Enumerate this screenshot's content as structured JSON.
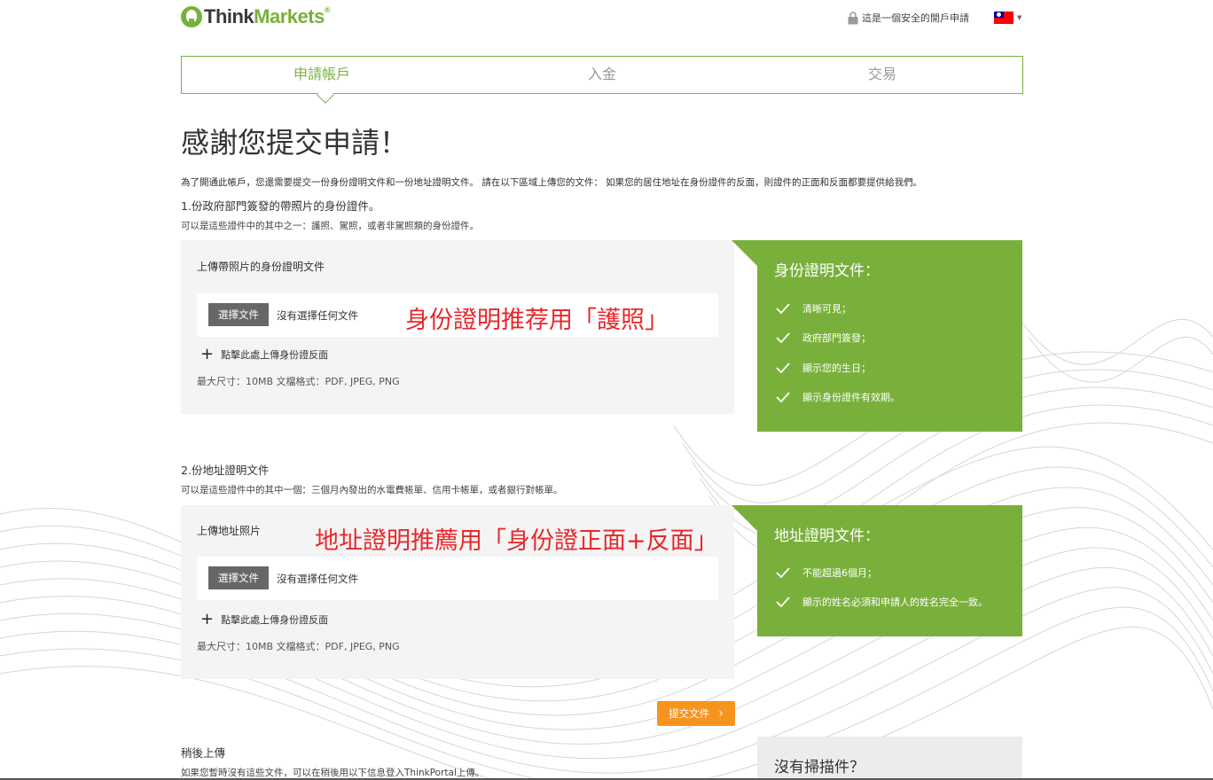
{
  "header": {
    "logo_think": "Think",
    "logo_markets": "Markets",
    "logo_reg": "®",
    "secure_text": "這是一個安全的開戶申請",
    "lock_icon": "lock-icon",
    "flag_icon": "taiwan-flag-icon"
  },
  "stepper": {
    "steps": [
      {
        "label": "申請帳戶",
        "active": true
      },
      {
        "label": "入金",
        "active": false
      },
      {
        "label": "交易",
        "active": false
      }
    ]
  },
  "main": {
    "title": "感謝您提交申請！",
    "intro": "為了開通此帳戶，您還需要提交一份身份證明文件和一份地址證明文件。 請在以下區域上傳您的文件： 如果您的居住地址在身份證件的反面，則證件的正面和反面都要提供給我們。",
    "section1": {
      "title": "1.份政府部門簽發的帶照片的身份證件。",
      "desc": "可以是這些證件中的其中之一：護照、駕照，或者非駕照類的身份證件。",
      "upload_label": "上傳帶照片的身份證明文件",
      "choose_button": "選擇文件",
      "no_file": "沒有選擇任何文件",
      "add_back": "點擊此處上傳身份證反面",
      "limits": "最大尺寸：10MB 文檔格式：PDF, JPEG, PNG",
      "annotation": "身份證明推荐用「護照」",
      "req_title": "身份證明文件：",
      "requirements": [
        "清晰可見；",
        "政府部門簽發；",
        "顯示您的生日；",
        "顯示身份證件有效期。"
      ]
    },
    "section2": {
      "title": "2.份地址證明文件",
      "desc": "可以是這些證件中的其中一個：三個月內發出的水電費帳單、信用卡帳單，或者銀行對帳單。",
      "upload_label": "上傳地址照片",
      "choose_button": "選擇文件",
      "no_file": "沒有選擇任何文件",
      "add_back": "點擊此處上傳身份證反面",
      "limits": "最大尺寸：10MB 文檔格式：PDF, JPEG, PNG",
      "annotation": "地址證明推薦用「身份證正面+反面」",
      "req_title": "地址證明文件：",
      "requirements": [
        "不能超過6個月；",
        "顯示的姓名必須和申請人的姓名完全一致。"
      ]
    },
    "submit_button": "提交文件",
    "later": {
      "title": "稍後上傳",
      "desc": "如果您暫時沒有這些文件，可以在稍後用以下信息登入ThinkPortal上傳。"
    },
    "noscan_title": "沒有掃描件？"
  },
  "colors": {
    "brand_green": "#79b03b",
    "accent_orange": "#f7941d",
    "annotation_red": "#e8272b"
  }
}
